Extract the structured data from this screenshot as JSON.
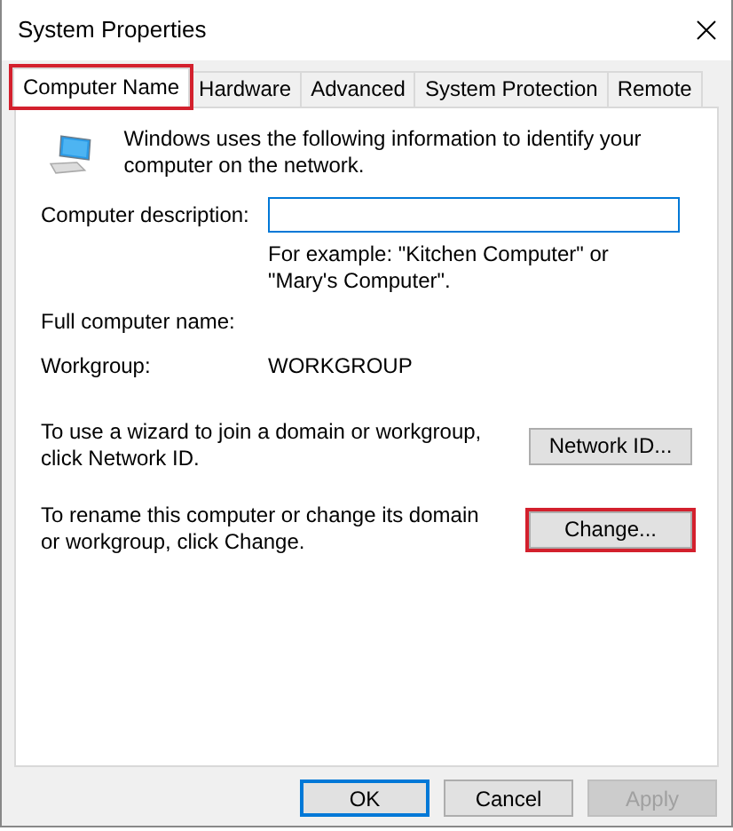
{
  "window": {
    "title": "System Properties"
  },
  "tabs": [
    {
      "label": "Computer Name",
      "selected": true,
      "highlighted": true
    },
    {
      "label": "Hardware",
      "selected": false,
      "highlighted": false
    },
    {
      "label": "Advanced",
      "selected": false,
      "highlighted": false
    },
    {
      "label": "System Protection",
      "selected": false,
      "highlighted": false
    },
    {
      "label": "Remote",
      "selected": false,
      "highlighted": false
    }
  ],
  "intro": "Windows uses the following information to identify your computer on the network.",
  "description": {
    "label": "Computer description:",
    "hint": "For example: \"Kitchen Computer\" or \"Mary's Computer\"."
  },
  "full_name": {
    "label": "Full computer name:"
  },
  "workgroup": {
    "label": "Workgroup:",
    "value": "WORKGROUP"
  },
  "actions": [
    {
      "text": "To use a wizard to join a domain or workgroup, click Network ID.",
      "button": "Network ID...",
      "highlighted": false
    },
    {
      "text": "To rename this computer or change its domain or workgroup, click Change.",
      "button": "Change...",
      "highlighted": true
    }
  ],
  "buttons": [
    {
      "label": "OK",
      "default": true,
      "disabled": false
    },
    {
      "label": "Cancel",
      "default": false,
      "disabled": false
    },
    {
      "label": "Apply",
      "default": false,
      "disabled": true
    }
  ]
}
